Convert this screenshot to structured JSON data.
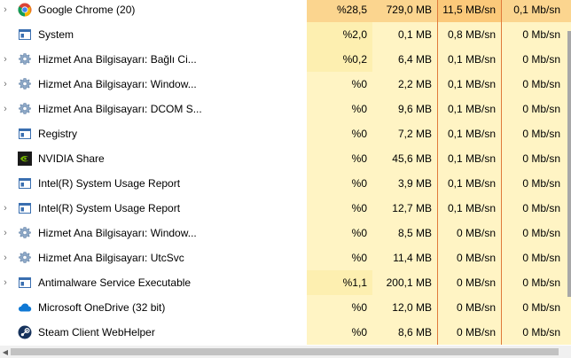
{
  "colors": {
    "cpu_strong": "#fbd58f",
    "cell_light": "#fff4c4",
    "cell_mid": "#fdefb0",
    "disk_highlight": "#fbc97a",
    "disk_border": "#e07a3b"
  },
  "rows": [
    {
      "name": "Google Chrome (20)",
      "icon": "chrome-icon",
      "expand": true,
      "cpu": "%28,5",
      "mem": "729,0 MB",
      "disk": "11,5 MB/sn",
      "net": "0,1 Mb/sn"
    },
    {
      "name": "System",
      "icon": "window-app-icon",
      "expand": false,
      "cpu": "%2,0",
      "mem": "0,1 MB",
      "disk": "0,8 MB/sn",
      "net": "0 Mb/sn"
    },
    {
      "name": "Hizmet Ana Bilgisayarı: Bağlı Ci...",
      "icon": "gear-icon",
      "expand": true,
      "cpu": "%0,2",
      "mem": "6,4 MB",
      "disk": "0,1 MB/sn",
      "net": "0 Mb/sn"
    },
    {
      "name": "Hizmet Ana Bilgisayarı: Window...",
      "icon": "gear-icon",
      "expand": true,
      "cpu": "%0",
      "mem": "2,2 MB",
      "disk": "0,1 MB/sn",
      "net": "0 Mb/sn"
    },
    {
      "name": "Hizmet Ana Bilgisayarı: DCOM S...",
      "icon": "gear-icon",
      "expand": true,
      "cpu": "%0",
      "mem": "9,6 MB",
      "disk": "0,1 MB/sn",
      "net": "0 Mb/sn"
    },
    {
      "name": "Registry",
      "icon": "window-app-icon",
      "expand": false,
      "cpu": "%0",
      "mem": "7,2 MB",
      "disk": "0,1 MB/sn",
      "net": "0 Mb/sn"
    },
    {
      "name": "NVIDIA Share",
      "icon": "nvidia-icon",
      "expand": false,
      "cpu": "%0",
      "mem": "45,6 MB",
      "disk": "0,1 MB/sn",
      "net": "0 Mb/sn"
    },
    {
      "name": "Intel(R) System Usage Report",
      "icon": "window-app-icon",
      "expand": false,
      "cpu": "%0",
      "mem": "3,9 MB",
      "disk": "0,1 MB/sn",
      "net": "0 Mb/sn"
    },
    {
      "name": "Intel(R) System Usage Report",
      "icon": "window-app-icon",
      "expand": true,
      "cpu": "%0",
      "mem": "12,7 MB",
      "disk": "0,1 MB/sn",
      "net": "0 Mb/sn"
    },
    {
      "name": "Hizmet Ana Bilgisayarı: Window...",
      "icon": "gear-icon",
      "expand": true,
      "cpu": "%0",
      "mem": "8,5 MB",
      "disk": "0 MB/sn",
      "net": "0 Mb/sn"
    },
    {
      "name": "Hizmet Ana Bilgisayarı: UtcSvc",
      "icon": "gear-icon",
      "expand": true,
      "cpu": "%0",
      "mem": "11,4 MB",
      "disk": "0 MB/sn",
      "net": "0 Mb/sn"
    },
    {
      "name": "Antimalware Service Executable",
      "icon": "window-app-icon",
      "expand": true,
      "cpu": "%1,1",
      "mem": "200,1 MB",
      "disk": "0 MB/sn",
      "net": "0 Mb/sn"
    },
    {
      "name": "Microsoft OneDrive (32 bit)",
      "icon": "onedrive-icon",
      "expand": false,
      "cpu": "%0",
      "mem": "12,0 MB",
      "disk": "0 MB/sn",
      "net": "0 Mb/sn"
    },
    {
      "name": "Steam Client WebHelper",
      "icon": "steam-icon",
      "expand": false,
      "cpu": "%0",
      "mem": "8,6 MB",
      "disk": "0 MB/sn",
      "net": "0 Mb/sn"
    }
  ]
}
